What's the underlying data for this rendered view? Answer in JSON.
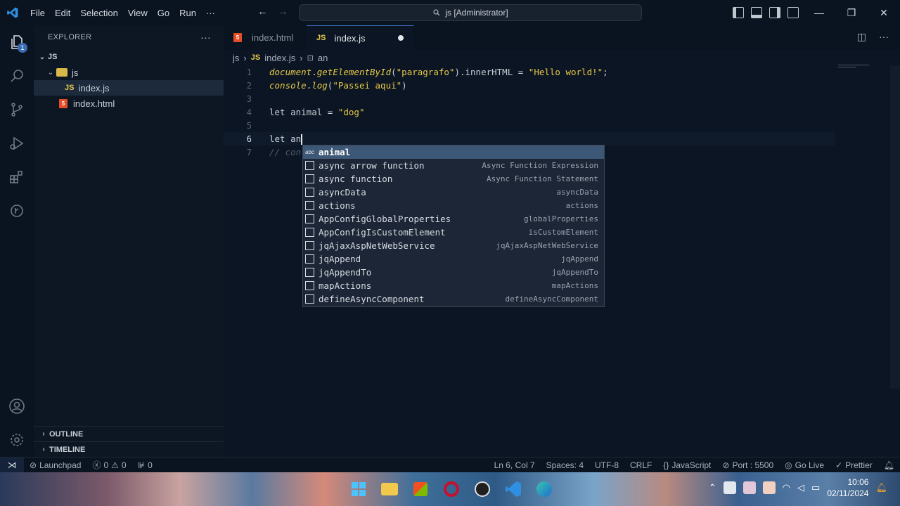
{
  "titlebar": {
    "menu": [
      "File",
      "Edit",
      "Selection",
      "View",
      "Go",
      "Run",
      "···"
    ],
    "command_center": "js [Administrator]"
  },
  "activity_bar": {
    "icons": [
      "explorer-icon",
      "search-icon",
      "source-control-icon",
      "run-debug-icon",
      "extensions-icon",
      "timeline-icon",
      "account-icon",
      "settings-icon"
    ],
    "explorer_badge": "1"
  },
  "sidebar": {
    "header": "EXPLORER",
    "more": "···",
    "root": "JS",
    "folder": "js",
    "files": [
      {
        "name": "index.js",
        "type": "JS",
        "selected": true
      },
      {
        "name": "index.html",
        "type": "html",
        "selected": false
      }
    ],
    "outline": "OUTLINE",
    "timeline": "TIMELINE"
  },
  "tabs": [
    {
      "label": "index.html",
      "type": "html",
      "active": false
    },
    {
      "label": "index.js",
      "type": "JS",
      "active": true,
      "dirty": true
    }
  ],
  "breadcrumb": {
    "folder": "js",
    "file": "index.js",
    "symbol": "an"
  },
  "editor": {
    "current_line": 6,
    "lines": [
      {
        "n": "1",
        "tokens": [
          [
            "fn",
            "document"
          ],
          [
            "p",
            "."
          ],
          [
            "fn",
            "getElementById"
          ],
          [
            "p",
            "("
          ],
          [
            "str",
            "\"paragrafo\""
          ],
          [
            "p",
            ").innerHTML = "
          ],
          [
            "str",
            "\"Hello world!\""
          ],
          [
            "p",
            ";"
          ]
        ]
      },
      {
        "n": "2",
        "tokens": [
          [
            "fn",
            "console"
          ],
          [
            "p",
            "."
          ],
          [
            "fn",
            "log"
          ],
          [
            "p",
            "("
          ],
          [
            "str",
            "\"Passei aqui\""
          ],
          [
            "p",
            ")"
          ]
        ]
      },
      {
        "n": "3",
        "tokens": []
      },
      {
        "n": "4",
        "tokens": [
          [
            "kw",
            "let"
          ],
          [
            "p",
            " animal = "
          ],
          [
            "str",
            "\"dog\""
          ]
        ]
      },
      {
        "n": "5",
        "tokens": []
      },
      {
        "n": "6",
        "tokens": [
          [
            "kw",
            "let"
          ],
          [
            "p",
            " an"
          ]
        ]
      },
      {
        "n": "7",
        "tokens": [
          [
            "com",
            "// con"
          ]
        ]
      }
    ]
  },
  "suggest": {
    "items": [
      {
        "icon": "abc",
        "label": "animal",
        "detail": ""
      },
      {
        "icon": "snippet",
        "label": "async arrow function",
        "detail": "Async Function Expression"
      },
      {
        "icon": "snippet",
        "label": "async function",
        "detail": "Async Function Statement"
      },
      {
        "icon": "snippet",
        "label": "asyncData",
        "detail": "asyncData"
      },
      {
        "icon": "snippet",
        "label": "actions",
        "detail": "actions"
      },
      {
        "icon": "snippet",
        "label": "AppConfigGlobalProperties",
        "detail": "globalProperties"
      },
      {
        "icon": "snippet",
        "label": "AppConfigIsCustomElement",
        "detail": "isCustomElement"
      },
      {
        "icon": "snippet",
        "label": "jqAjaxAspNetWebService",
        "detail": "jqAjaxAspNetWebService"
      },
      {
        "icon": "snippet",
        "label": "jqAppend",
        "detail": "jqAppend"
      },
      {
        "icon": "snippet",
        "label": "jqAppendTo",
        "detail": "jqAppendTo"
      },
      {
        "icon": "snippet",
        "label": "mapActions",
        "detail": "mapActions"
      },
      {
        "icon": "snippet",
        "label": "defineAsyncComponent",
        "detail": "defineAsyncComponent"
      }
    ]
  },
  "statusbar": {
    "launchpad": "Launchpad",
    "errors": "0",
    "warnings": "0",
    "ports_count": "0",
    "position": "Ln 6, Col 7",
    "spaces": "Spaces: 4",
    "encoding": "UTF-8",
    "eol": "CRLF",
    "language": "JavaScript",
    "port": "Port : 5500",
    "go_live": "Go Live",
    "prettier": "Prettier"
  },
  "taskbar": {
    "time": "10:06",
    "date": "02/11/2024"
  }
}
